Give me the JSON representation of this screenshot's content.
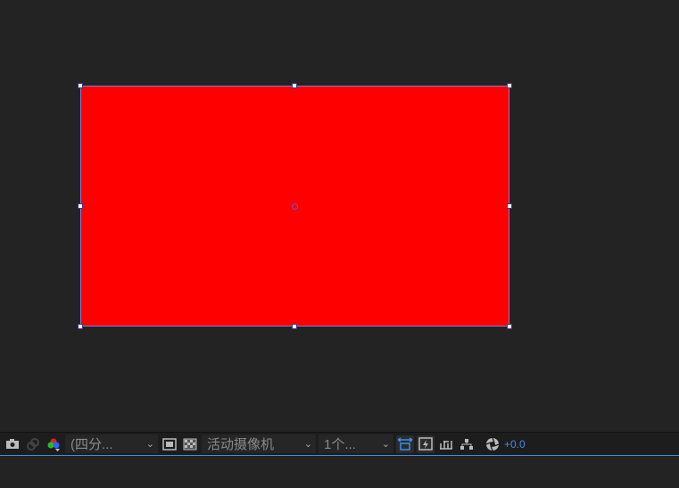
{
  "layer": {
    "color": "#ff0000"
  },
  "toolbar": {
    "resolution": "(四分...",
    "camera": "活动摄像机",
    "views": "1个...",
    "exposure": "+0.0",
    "accent": "#3d8ee8"
  }
}
